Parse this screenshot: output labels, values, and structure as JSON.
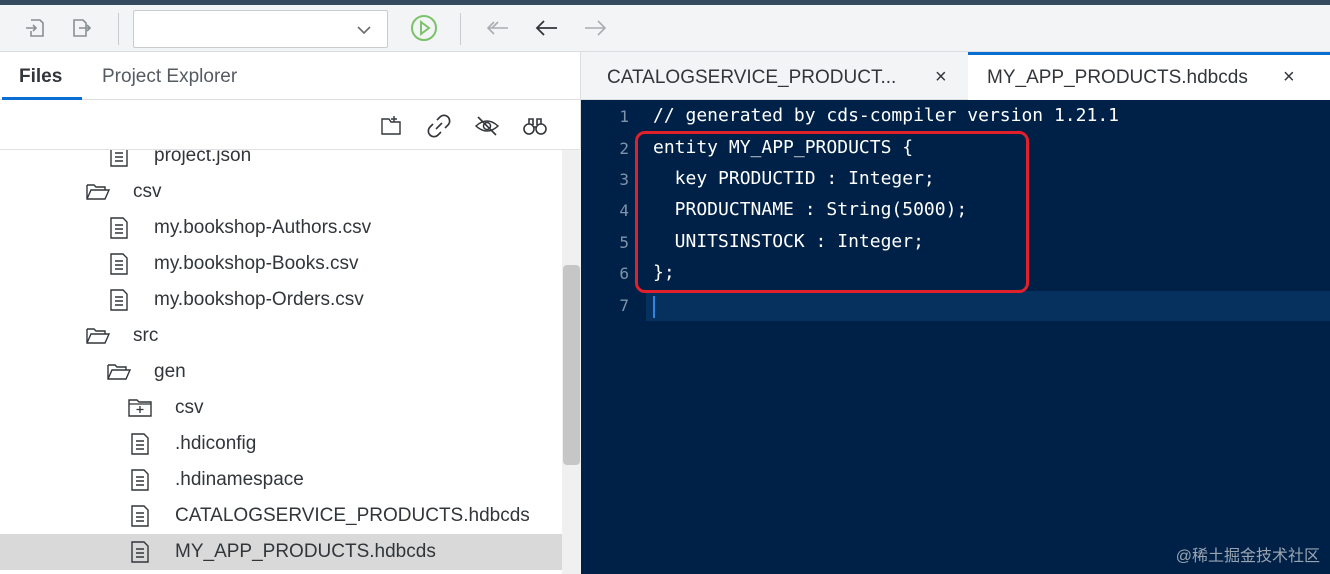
{
  "toolbar": {
    "dropdown_value": "",
    "icons": [
      "import-icon",
      "export-icon",
      "run-icon",
      "back-all-icon",
      "back-icon",
      "forward-icon"
    ]
  },
  "sidebar": {
    "tabs": [
      {
        "label": "Files",
        "active": true
      },
      {
        "label": "Project Explorer",
        "active": false
      }
    ],
    "tools": [
      "new-folder-icon",
      "link-icon",
      "hide-icon",
      "binoculars-icon"
    ],
    "tree": [
      {
        "label": "project.json",
        "type": "file",
        "indent": 1
      },
      {
        "label": "csv",
        "type": "folder-open",
        "indent": 0
      },
      {
        "label": "my.bookshop-Authors.csv",
        "type": "file",
        "indent": 1
      },
      {
        "label": "my.bookshop-Books.csv",
        "type": "file",
        "indent": 1
      },
      {
        "label": "my.bookshop-Orders.csv",
        "type": "file",
        "indent": 1
      },
      {
        "label": "src",
        "type": "folder-open",
        "indent": 0
      },
      {
        "label": "gen",
        "type": "folder-open",
        "indent": 1
      },
      {
        "label": "csv",
        "type": "folder-plus",
        "indent": 2
      },
      {
        "label": ".hdiconfig",
        "type": "file",
        "indent": 2
      },
      {
        "label": ".hdinamespace",
        "type": "file",
        "indent": 2
      },
      {
        "label": "CATALOGSERVICE_PRODUCTS.hdbcds",
        "type": "file",
        "indent": 2
      },
      {
        "label": "MY_APP_PRODUCTS.hdbcds",
        "type": "file",
        "indent": 2,
        "selected": true
      }
    ]
  },
  "editor": {
    "tabs": [
      {
        "title": "CATALOGSERVICE_PRODUCT...",
        "close": "×",
        "active": false
      },
      {
        "title": "MY_APP_PRODUCTS.hdbcds",
        "close": "×",
        "active": true
      }
    ],
    "lines": [
      {
        "num": "1",
        "text": "// generated by cds-compiler version 1.21.1"
      },
      {
        "num": "2",
        "text": "entity MY_APP_PRODUCTS {"
      },
      {
        "num": "3",
        "text": "  key PRODUCTID : Integer;"
      },
      {
        "num": "4",
        "text": "  PRODUCTNAME : String(5000);"
      },
      {
        "num": "5",
        "text": "  UNITSINSTOCK : Integer;"
      },
      {
        "num": "6",
        "text": "};"
      },
      {
        "num": "7",
        "text": ""
      }
    ],
    "highlight_color": "#e0202a",
    "background": "#002147"
  },
  "watermark": "@稀土掘金技术社区"
}
